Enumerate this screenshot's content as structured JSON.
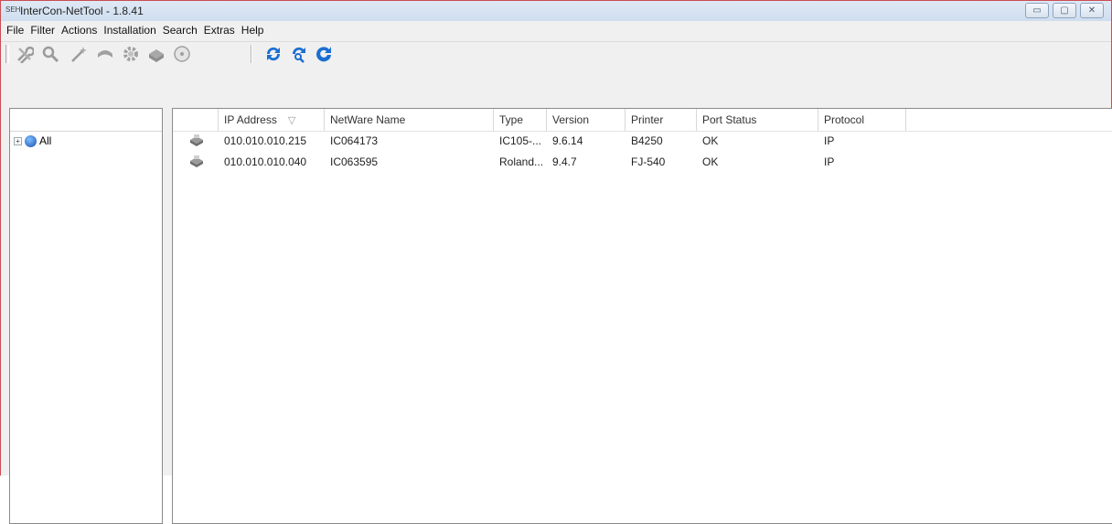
{
  "window": {
    "app_icon_text": "SEH",
    "title": "InterCon-NetTool - 1.8.41"
  },
  "window_controls": {
    "minimize": "▭",
    "maximize": "▢",
    "close": "✕"
  },
  "menu": [
    "File",
    "Filter",
    "Actions",
    "Installation",
    "Search",
    "Extras",
    "Help"
  ],
  "toolbar": {
    "disabled_tools": [
      "wrench-icon",
      "magnifier-icon",
      "wand-icon",
      "undo-icon",
      "gear-icon",
      "printer-icon",
      "disc-icon"
    ],
    "active_tools": [
      "refresh-icon",
      "search-refresh-icon",
      "reload-icon"
    ]
  },
  "tree": {
    "root_label": "All",
    "expander": "+"
  },
  "table": {
    "columns": [
      "",
      "IP Address",
      "NetWare Name",
      "Type",
      "Version",
      "Printer",
      "Port Status",
      "Protocol"
    ],
    "sort_indicator": "▽",
    "rows": [
      {
        "ip": "010.010.010.215",
        "netware": "IC064173",
        "type": "IC105-...",
        "version": "9.6.14",
        "printer": "B4250",
        "port_status": "OK",
        "protocol": "IP"
      },
      {
        "ip": "010.010.010.040",
        "netware": "IC063595",
        "type": "Roland...",
        "version": "9.4.7",
        "printer": "FJ-540",
        "port_status": "OK",
        "protocol": "IP"
      }
    ]
  },
  "colors": {
    "title_border": "#c94d52",
    "toolbar_blue": "#1a6fd1"
  }
}
